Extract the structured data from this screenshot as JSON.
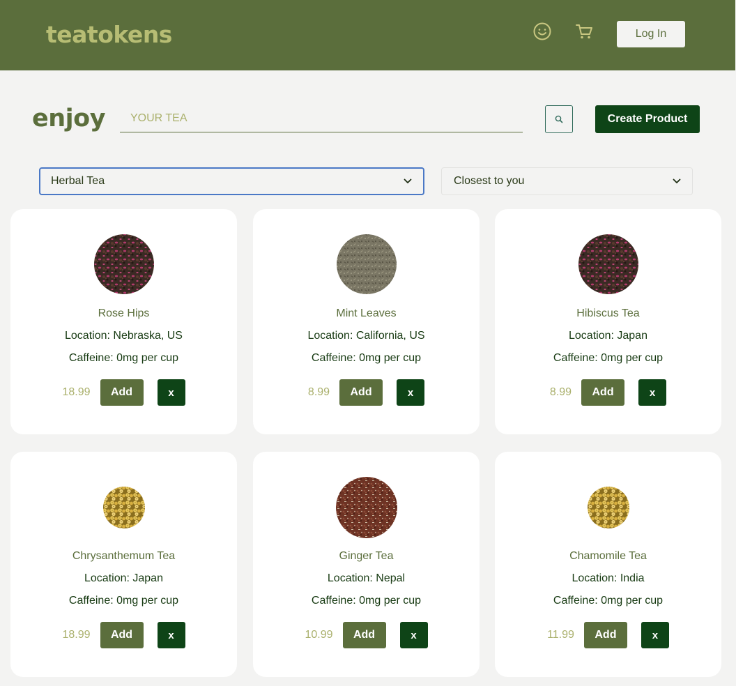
{
  "header": {
    "logo": "teatokens",
    "login_label": "Log In"
  },
  "search": {
    "heading": "enjoy",
    "placeholder": "YOUR TEA",
    "create_label": "Create Product"
  },
  "filters": {
    "category": "Herbal Tea",
    "sort": "Closest to you"
  },
  "colors": {
    "brand_green": "#5b6e3c",
    "dark_green": "#0e4417",
    "accent_olive": "#aab06c"
  },
  "products": [
    {
      "name": "Rose Hips",
      "location": "Location: Nebraska, US",
      "caffeine": "Caffeine: 0mg per cup",
      "price": "18.99",
      "add_label": "Add",
      "remove_label": "x"
    },
    {
      "name": "Mint Leaves",
      "location": "Location: California, US",
      "caffeine": "Caffeine: 0mg per cup",
      "price": "8.99",
      "add_label": "Add",
      "remove_label": "x"
    },
    {
      "name": "Hibiscus Tea",
      "location": "Location: Japan",
      "caffeine": "Caffeine: 0mg per cup",
      "price": "8.99",
      "add_label": "Add",
      "remove_label": "x"
    },
    {
      "name": "Chrysanthemum Tea",
      "location": "Location: Japan",
      "caffeine": "Caffeine: 0mg per cup",
      "price": "18.99",
      "add_label": "Add",
      "remove_label": "x"
    },
    {
      "name": "Ginger Tea",
      "location": "Location: Nepal",
      "caffeine": "Caffeine: 0mg per cup",
      "price": "10.99",
      "add_label": "Add",
      "remove_label": "x"
    },
    {
      "name": "Chamomile Tea",
      "location": "Location: India",
      "caffeine": "Caffeine: 0mg per cup",
      "price": "11.99",
      "add_label": "Add",
      "remove_label": "x"
    }
  ]
}
